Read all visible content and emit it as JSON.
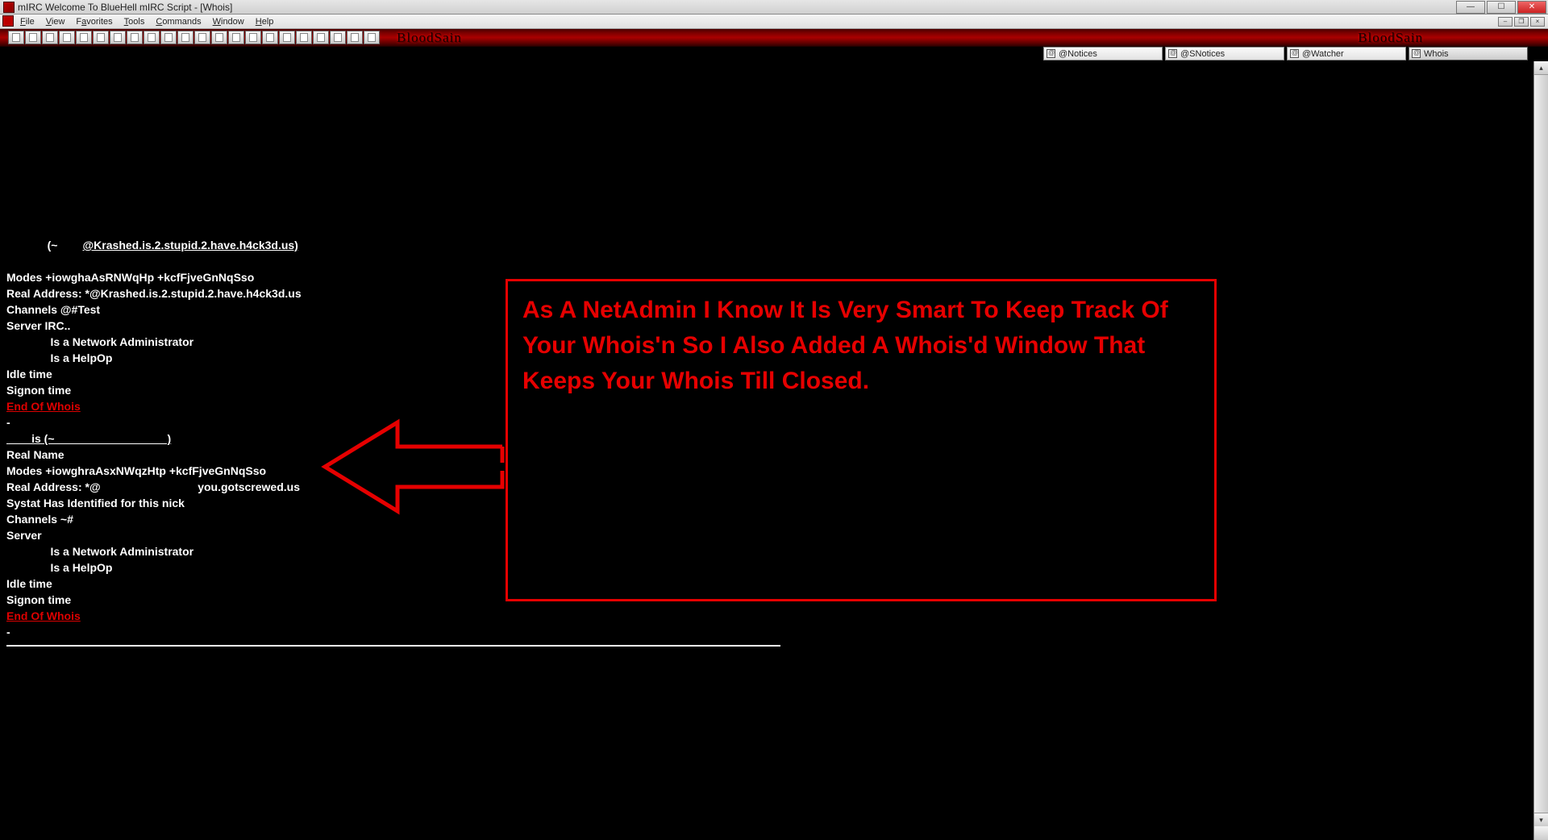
{
  "window": {
    "title": "mIRC Welcome To BlueHell mIRC Script - [Whois]"
  },
  "menu": {
    "items": [
      "File",
      "View",
      "Favorites",
      "Tools",
      "Commands",
      "Window",
      "Help"
    ]
  },
  "toolbar": {
    "brand": "BloodSain"
  },
  "tabs": [
    {
      "label": "@Notices",
      "active": false
    },
    {
      "label": "@SNotices",
      "active": false
    },
    {
      "label": "@Watcher",
      "active": false
    },
    {
      "label": "Whois",
      "active": true
    }
  ],
  "annotation": {
    "text": "As A NetAdmin I Know It Is Very Smart To Keep Track Of Your Whois'n So I Also Added A Whois'd Window That Keeps Your Whois Till Closed."
  },
  "whois": {
    "entry1": {
      "header_prefix": "             (~",
      "header_host": "@Krashed.is.2.stupid.2.have.h4ck3d.us)",
      "lines": [
        "Modes +iowghaAsRNWqHp +kcfFjveGnNqSso",
        "Real Address: *@Krashed.is.2.stupid.2.have.h4ck3d.us",
        "Channels @#Test",
        "Server IRC..",
        "              Is a Network Administrator",
        "              Is a HelpOp",
        "Idle time",
        "Signon time"
      ],
      "end": "End Of Whois",
      "dash": "-"
    },
    "entry2": {
      "header": "        is (~                                    )",
      "lines": [
        "Real Name",
        "Modes +iowghraAsxNWqzHtp +kcfFjveGnNqSso",
        "Real Address: *@                               you.gotscrewed.us",
        "Systat Has Identified for this nick",
        "Channels ~#",
        "Server",
        "              Is a Network Administrator",
        "              Is a HelpOp",
        "Idle time",
        "Signon time"
      ],
      "end": "End Of Whois",
      "dash": "-"
    }
  }
}
